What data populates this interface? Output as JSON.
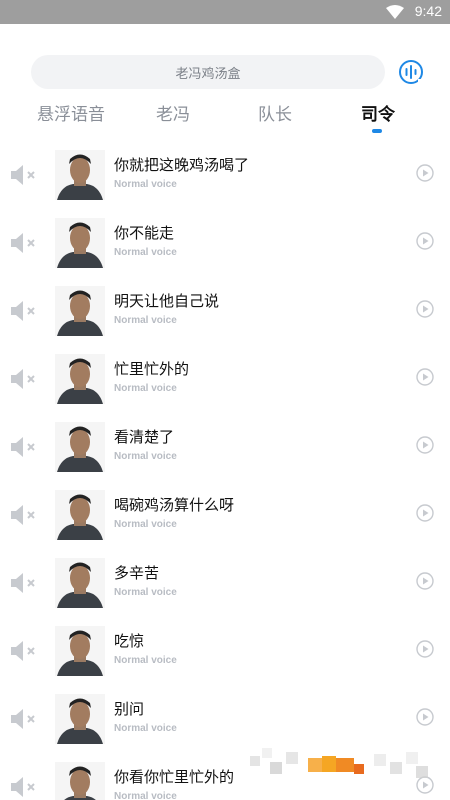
{
  "status_bar": {
    "time": "9:42"
  },
  "search": {
    "placeholder": "老冯鸡汤盒"
  },
  "tabs": [
    {
      "label": "悬浮语音"
    },
    {
      "label": "老冯"
    },
    {
      "label": "队长"
    },
    {
      "label": "司令",
      "active": true
    }
  ],
  "list": {
    "items": [
      {
        "title": "你就把这晚鸡汤喝了",
        "subtitle": "Normal voice"
      },
      {
        "title": "你不能走",
        "subtitle": "Normal voice"
      },
      {
        "title": "明天让他自己说",
        "subtitle": "Normal voice"
      },
      {
        "title": "忙里忙外的",
        "subtitle": "Normal voice"
      },
      {
        "title": "看清楚了",
        "subtitle": "Normal voice"
      },
      {
        "title": "喝碗鸡汤算什么呀",
        "subtitle": "Normal voice"
      },
      {
        "title": "多辛苦",
        "subtitle": "Normal voice"
      },
      {
        "title": "吃惊",
        "subtitle": "Normal voice"
      },
      {
        "title": "别问",
        "subtitle": "Normal voice"
      },
      {
        "title": "你看你忙里忙外的",
        "subtitle": "Normal voice"
      }
    ]
  },
  "colors": {
    "status_bar": "#9e9e9e",
    "accent": "#1e88e5",
    "search_bg": "#f2f3f5",
    "tab_inactive": "#8a8f98",
    "subtitle": "#b8bcc3",
    "icon_gray": "#c7cacf"
  },
  "icons": {
    "wifi": "wifi-icon",
    "voice": "voice-wave-icon",
    "mute": "speaker-muted-icon",
    "play": "play-circle-icon",
    "avatar": "avatar"
  }
}
